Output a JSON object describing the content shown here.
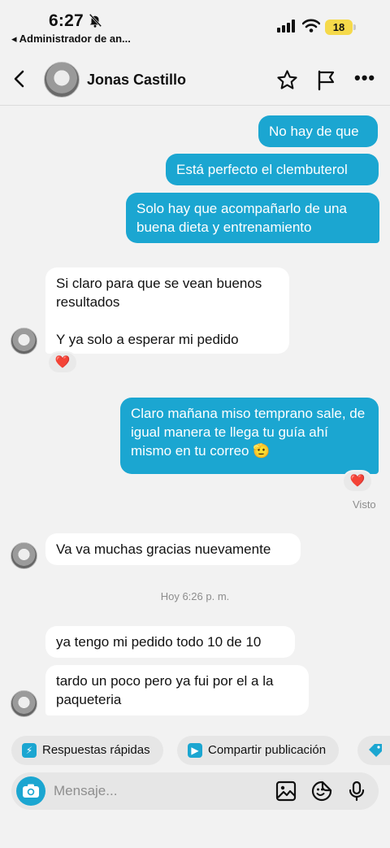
{
  "status_bar": {
    "time": "6:27",
    "back_app": "◂ Administrador de an...",
    "battery": "18"
  },
  "header": {
    "contact_name": "Jonas Castillo"
  },
  "messages": [
    {
      "direction": "outgoing",
      "text": "No hay de que"
    },
    {
      "direction": "outgoing",
      "text": "Está perfecto el clembuterol"
    },
    {
      "direction": "outgoing",
      "text": "Solo hay que acompañarlo de una buena dieta y entrenamiento"
    },
    {
      "direction": "incoming",
      "text": "Si claro para que se vean buenos resultados\n\nY ya solo a esperar mi pedido",
      "reaction": "❤️"
    },
    {
      "direction": "outgoing",
      "text": "Claro mañana miso temprano sale, de igual manera te llega tu guía ahí mismo en tu correo 🫡",
      "reaction": "❤️"
    },
    {
      "direction": "incoming",
      "text": "Va va muchas gracias nuevamente"
    },
    {
      "direction": "incoming",
      "text": "ya tengo mi pedido todo 10 de 10"
    },
    {
      "direction": "incoming",
      "text": "tardo un poco pero ya fui por el a la paqueteria"
    }
  ],
  "seen_label": "Visto",
  "timestamp": "Hoy 6:26 p. m.",
  "quick_actions": [
    {
      "label": "Respuestas rápidas",
      "icon": "lightning-icon"
    },
    {
      "label": "Compartir publicación",
      "icon": "play-icon"
    },
    {
      "label": "",
      "icon": "tag-icon"
    }
  ],
  "composer": {
    "placeholder": "Mensaje..."
  },
  "colors": {
    "accent": "#1ba6d1",
    "background": "#f2f2f2",
    "incoming_bubble": "#ffffff",
    "reaction_heart": "#e0142b"
  }
}
